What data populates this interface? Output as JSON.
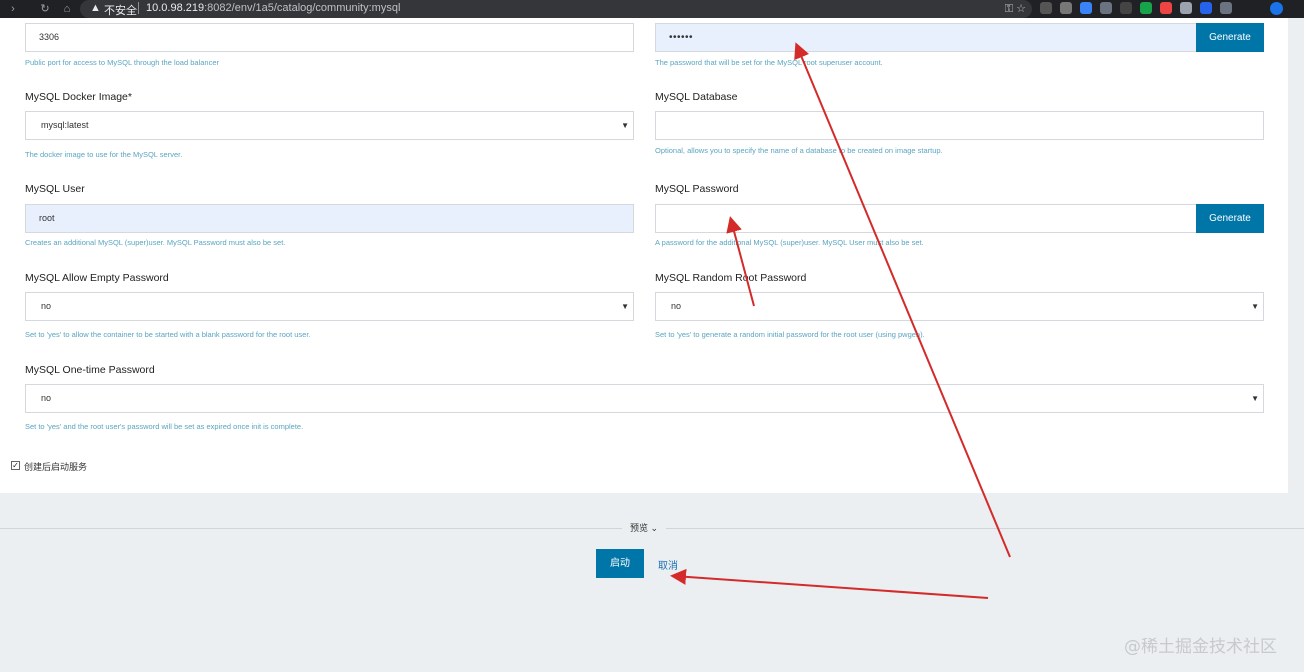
{
  "browser": {
    "insecure_label": "不安全",
    "url_host": "10.0.98.219",
    "url_path": ":8082/env/1a5/catalog/community:mysql"
  },
  "form": {
    "root_password": {
      "value": "••••••",
      "generate_label": "Generate",
      "help": "The password that will be set for the MySQL root superuser account."
    },
    "port": {
      "value": "3306",
      "help": "Public port for access to MySQL through the load balancer"
    },
    "docker_image": {
      "label": "MySQL Docker Image*",
      "value": "mysql:latest",
      "help": "The docker image to use for the MySQL server."
    },
    "database": {
      "label": "MySQL Database",
      "value": "",
      "help": "Optional, allows you to specify the name of a database to be created on image startup."
    },
    "user": {
      "label": "MySQL User",
      "value": "root",
      "help": "Creates an additional MySQL (super)user. MySQL Password must also be set."
    },
    "password": {
      "label": "MySQL Password",
      "value": "",
      "generate_label": "Generate",
      "help": "A password for the additional MySQL (super)user. MySQL User must also be set."
    },
    "allow_empty_password": {
      "label": "MySQL Allow Empty Password",
      "value": "no",
      "help": "Set to 'yes' to allow the container to be started with a blank password for the root user."
    },
    "random_root_password": {
      "label": "MySQL Random Root Password",
      "value": "no",
      "help": "Set to 'yes' to generate a random initial password for the root user (using pwgen)."
    },
    "onetime_password": {
      "label": "MySQL One-time Password",
      "value": "no",
      "help": "Set to 'yes' and the root user's password will be set as expired once init is complete."
    },
    "start_after_create": {
      "label": "创建后启动服务",
      "checked": true
    }
  },
  "footer": {
    "preview_label": "预览",
    "launch_label": "启动",
    "cancel_label": "取消"
  },
  "watermark": "@稀土掘金技术社区",
  "colors": {
    "primary": "#0075a8",
    "help_text": "#5aa5c0",
    "autofill_bg": "#e8f0fe",
    "annotation_arrow": "#d42a2a"
  }
}
